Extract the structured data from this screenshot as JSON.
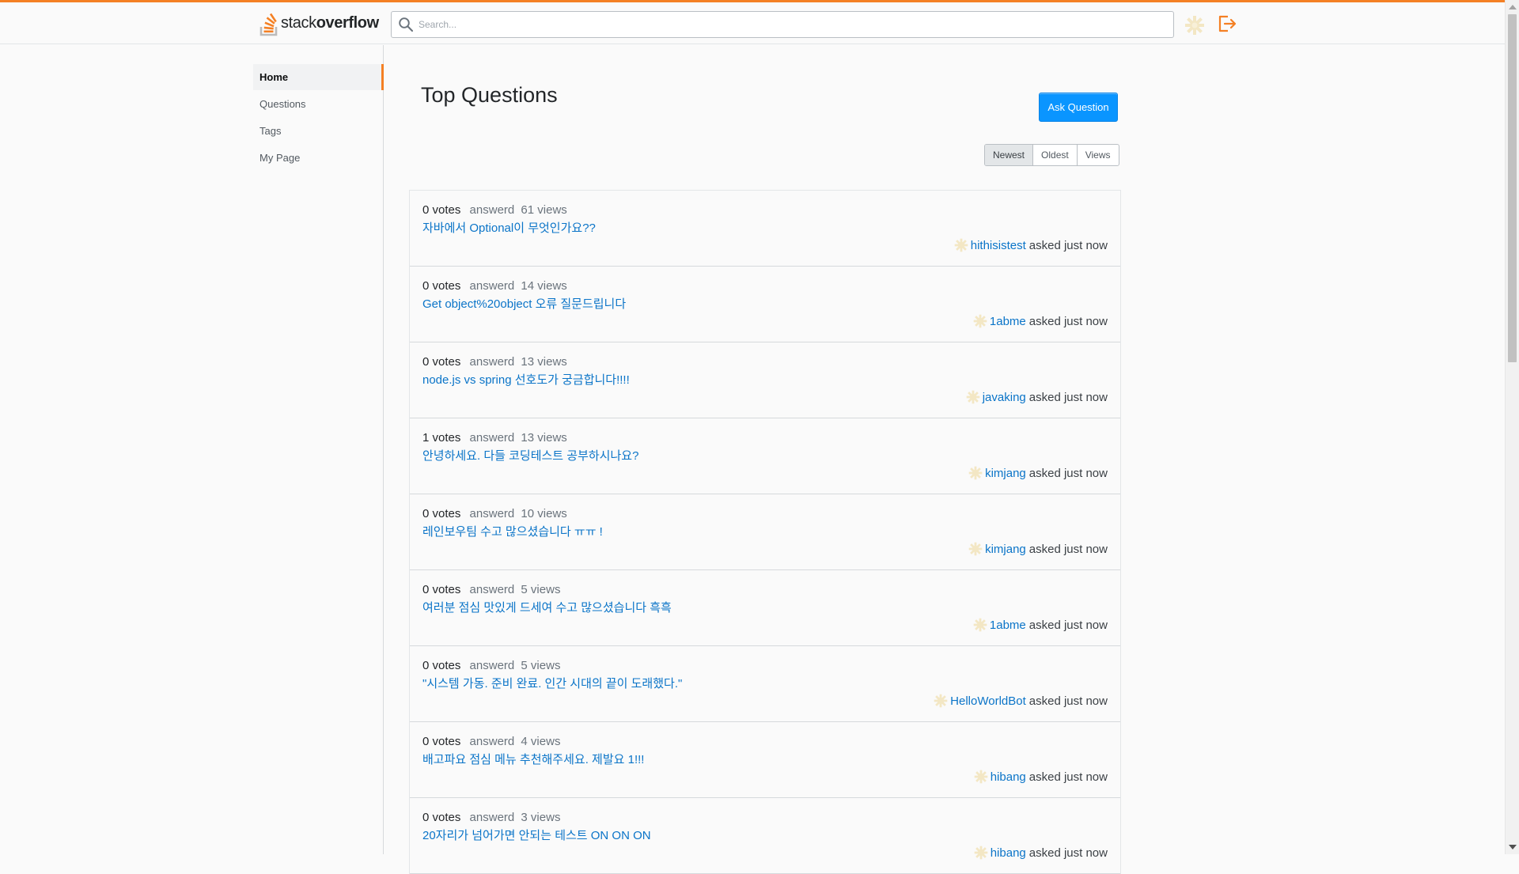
{
  "header": {
    "logo": {
      "stack": "stack",
      "overflow": "overflow"
    },
    "search": {
      "placeholder": "Search..."
    },
    "accent_color": "#f48024"
  },
  "sidebar": {
    "items": [
      {
        "label": "Home",
        "active": true
      },
      {
        "label": "Questions",
        "active": false
      },
      {
        "label": "Tags",
        "active": false
      },
      {
        "label": "My Page",
        "active": false
      }
    ]
  },
  "main": {
    "title": "Top Questions",
    "ask_button": "Ask Question",
    "sort": {
      "options": [
        "Newest",
        "Oldest",
        "Views"
      ],
      "selected": "Newest"
    },
    "questions": [
      {
        "votes": "0 votes",
        "answers": "answerd",
        "views": "61 views",
        "title": "자바에서 Optional이 무엇인가요??",
        "user": "hithisistest",
        "asked": "asked just now"
      },
      {
        "votes": "0 votes",
        "answers": "answerd",
        "views": "14 views",
        "title": "Get object%20object 오류 질문드립니다",
        "user": "1abme",
        "asked": "asked just now"
      },
      {
        "votes": "0 votes",
        "answers": "answerd",
        "views": "13 views",
        "title": "node.js vs spring 선호도가 궁금합니다!!!!",
        "user": "javaking",
        "asked": "asked just now"
      },
      {
        "votes": "1 votes",
        "answers": "answerd",
        "views": "13 views",
        "title": "안녕하세요. 다들 코딩테스트 공부하시나요?",
        "user": "kimjang",
        "asked": "asked just now"
      },
      {
        "votes": "0 votes",
        "answers": "answerd",
        "views": "10 views",
        "title": "레인보우팀 수고 많으셨습니다 ㅠㅠ !",
        "user": "kimjang",
        "asked": "asked just now"
      },
      {
        "votes": "0 votes",
        "answers": "answerd",
        "views": "5 views",
        "title": "여러분 점심 맛있게 드세여 수고 많으셨습니다 흑흑",
        "user": "1abme",
        "asked": "asked just now"
      },
      {
        "votes": "0 votes",
        "answers": "answerd",
        "views": "5 views",
        "title": "\"시스템 가동. 준비 완료. 인간 시대의 끝이 도래했다.\"",
        "user": "HelloWorldBot",
        "asked": "asked just now"
      },
      {
        "votes": "0 votes",
        "answers": "answerd",
        "views": "4 views",
        "title": "배고파요 점심 메뉴 추천해주세요. 제발요 1!!!",
        "user": "hibang",
        "asked": "asked just now"
      },
      {
        "votes": "0 votes",
        "answers": "answerd",
        "views": "3 views",
        "title": "20자리가 넘어가면 안되는 테스트 ON ON ON",
        "user": "hibang",
        "asked": "asked just now"
      }
    ]
  },
  "colors": {
    "link": "#0a74c8",
    "primary_button": "#0a95ff"
  },
  "icons": {
    "logo": "stackoverflow-logo-icon",
    "search": "search-icon",
    "avatar": "avatar-icon",
    "logout": "logout-icon"
  }
}
